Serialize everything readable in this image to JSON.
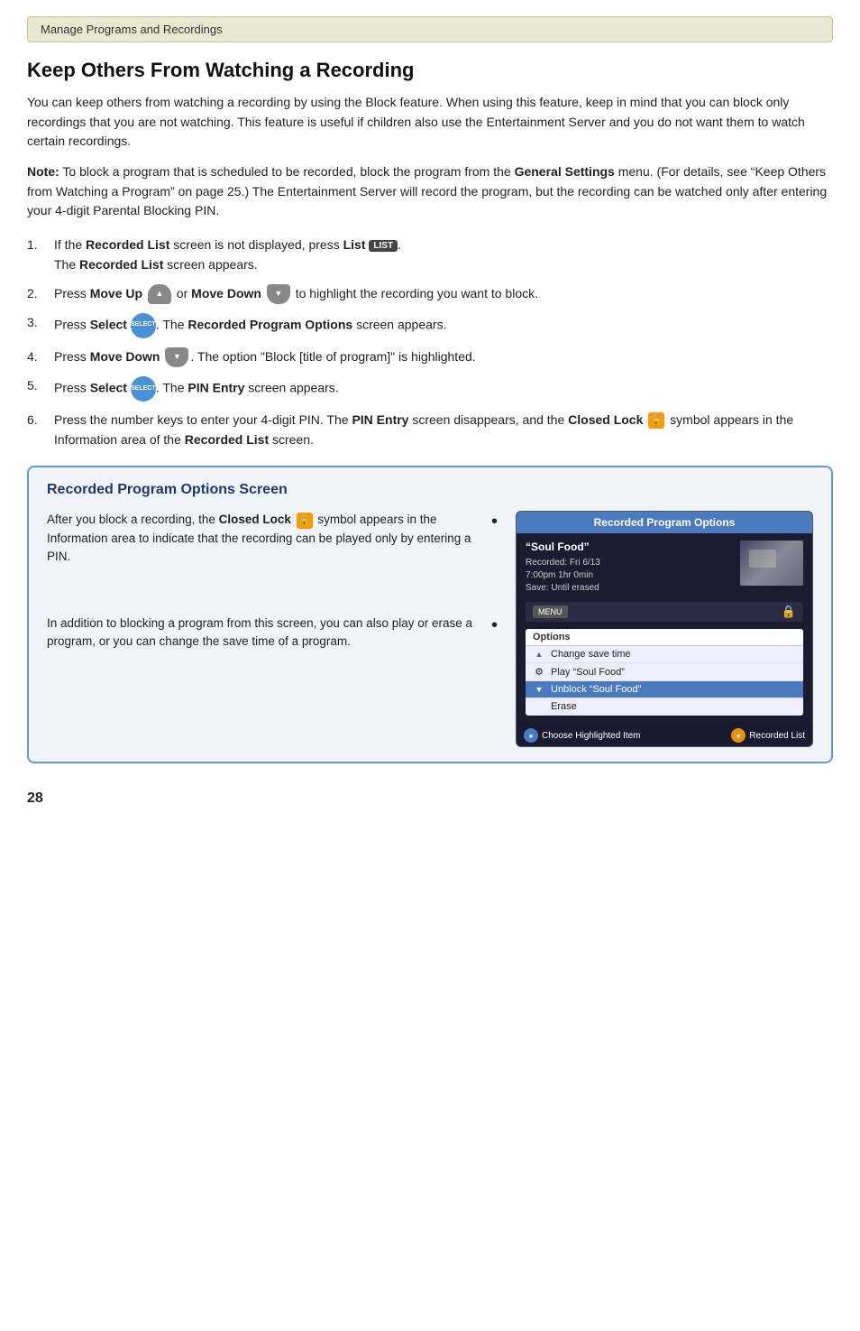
{
  "breadcrumb": {
    "text": "Manage Programs and Recordings"
  },
  "heading": {
    "title": "Keep Others From Watching a Recording"
  },
  "intro": {
    "paragraph": "You can keep others from watching a recording by using the Block feature. When using this feature, keep in mind that you can block only recordings that you are not watching. This feature is useful if children also use the Entertainment Server and you do not want them to watch certain recordings."
  },
  "note": {
    "label": "Note:",
    "text": " To block a program that is scheduled to be recorded, block the program from the ",
    "bold1": "General Settings",
    "text2": " menu. (For details, see “Keep Others from Watching a Program” on page 25.) The Entertainment Server will record the program, but the recording can be watched only after entering your 4-digit Parental Blocking PIN."
  },
  "steps": [
    {
      "num": "1.",
      "text_pre": "If the ",
      "bold1": "Recorded List",
      "text_mid": " screen is not displayed, press ",
      "bold2": "List",
      "button": "LIST",
      "text_post": ".\nThe ",
      "bold3": "Recorded List",
      "text_end": " screen appears."
    },
    {
      "num": "2.",
      "text_pre": "Press ",
      "bold1": "Move Up",
      "arrow_up": "▲",
      "text_mid": " or ",
      "bold2": "Move Down",
      "arrow_down": "▼",
      "text_post": " to highlight the recording you want to block."
    },
    {
      "num": "3.",
      "text_pre": "Press ",
      "bold1": "Select",
      "button": "SELECT",
      "text_mid": ". The ",
      "bold2": "Recorded Program Options",
      "text_post": " screen appears."
    },
    {
      "num": "4.",
      "text_pre": "Press ",
      "bold1": "Move Down",
      "arrow_down": "▼",
      "text_mid": ". The option “Block [title of program]” is highlighted."
    },
    {
      "num": "5.",
      "text_pre": "Press ",
      "bold1": "Select",
      "button": "SELECT",
      "text_mid": ". The ",
      "bold2": "PIN Entry",
      "text_post": " screen appears."
    },
    {
      "num": "6.",
      "text_pre": "Press the number keys to enter your 4-digit PIN. The ",
      "bold1": "PIN Entry",
      "text_mid": " screen disappears, and the ",
      "bold2": "Closed Lock",
      "text_post": " symbol appears in the Information area of the ",
      "bold3": "Recorded List",
      "text_end": " screen."
    }
  ],
  "options_box": {
    "title": "Recorded Program Options Screen",
    "left_para1_pre": "After you block a recording, the ",
    "left_para1_bold": "Closed Lock",
    "left_para1_post": " symbol appears in the Information area to indicate that the recording can be played only by entering a PIN.",
    "left_para2_pre": "In addition to blocking a program from this screen, you can also play or erase a program, or you can change the save time of a program.",
    "screen": {
      "header": "Recorded Program Options",
      "program_title": "“Soul Food”",
      "recorded_line": "Recorded: Fri  6/13",
      "time_line": "7:00pm  1hr  0min",
      "save_line": "Save: Until erased",
      "options_header": "Options",
      "menu_items": [
        {
          "label": "Change save time",
          "type": "up-arrow"
        },
        {
          "label": "Play “Soul Food”",
          "type": "gear"
        },
        {
          "label": "Unblock “Soul Food”",
          "type": "down-arrow",
          "highlighted": true
        },
        {
          "label": "Erase",
          "type": "none"
        }
      ],
      "bottom_left_icon": "circle-blue",
      "bottom_left_text": "Choose Highlighted Item",
      "bottom_right_icon": "circle-orange",
      "bottom_right_text": "Recorded List"
    }
  },
  "page_number": "28"
}
